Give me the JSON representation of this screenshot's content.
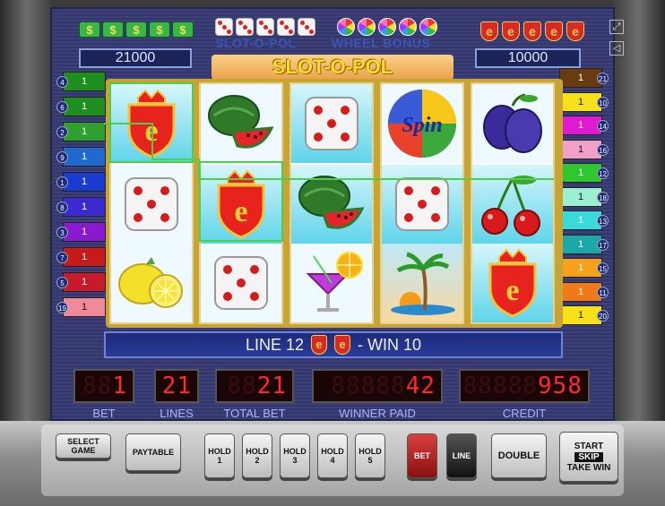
{
  "game": {
    "title": "SLOT-O-POL",
    "bonus_left": "SLOT-O-POL",
    "bonus_right": "WHEEL BONUS",
    "jackpot_left": "21000",
    "jackpot_right": "10000",
    "dollar_symbols": [
      "$",
      "$",
      "$",
      "$",
      "$"
    ],
    "shield_symbols": [
      "e",
      "e",
      "e",
      "e",
      "e"
    ]
  },
  "reels": [
    [
      "shield-e",
      "dice",
      "lemon"
    ],
    [
      "watermelon",
      "shield-e",
      "dice"
    ],
    [
      "dice",
      "watermelon",
      "cocktail"
    ],
    [
      "spin-wheel",
      "dice",
      "palm-island"
    ],
    [
      "plum",
      "cherry",
      "shield-e"
    ]
  ],
  "reel_symbol_labels": {
    "spin": "Spin",
    "shield": "e"
  },
  "line_markers_left": [
    {
      "num": "4",
      "value": "1",
      "color": "#1e8f1e"
    },
    {
      "num": "6",
      "value": "1",
      "color": "#1e8f1e"
    },
    {
      "num": "2",
      "value": "1",
      "color": "#2f9f2f"
    },
    {
      "num": "9",
      "value": "1",
      "color": "#1e6ad0"
    },
    {
      "num": "1",
      "value": "1",
      "color": "#1a3bd0"
    },
    {
      "num": "8",
      "value": "1",
      "color": "#3a2ad0"
    },
    {
      "num": "3",
      "value": "1",
      "color": "#8a1ad0"
    },
    {
      "num": "7",
      "value": "1",
      "color": "#c81a1a"
    },
    {
      "num": "5",
      "value": "1",
      "color": "#c81a2a"
    },
    {
      "num": "19",
      "value": "1",
      "color": "#f08a9a"
    }
  ],
  "line_markers_right": [
    {
      "num": "21",
      "value": "1",
      "color": "#6a3a10"
    },
    {
      "num": "10",
      "value": "1",
      "color": "#f7e21a"
    },
    {
      "num": "14",
      "value": "1",
      "color": "#e01ad0"
    },
    {
      "num": "16",
      "value": "1",
      "color": "#f3a0c8"
    },
    {
      "num": "12",
      "value": "1",
      "color": "#2ec82e"
    },
    {
      "num": "18",
      "value": "1",
      "color": "#9af0d0"
    },
    {
      "num": "13",
      "value": "1",
      "color": "#3adada"
    },
    {
      "num": "17",
      "value": "1",
      "color": "#1aa8a8"
    },
    {
      "num": "15",
      "value": "1",
      "color": "#f7a01a"
    },
    {
      "num": "11",
      "value": "1",
      "color": "#f07a1a"
    },
    {
      "num": "20",
      "value": "1",
      "color": "#f7e21a"
    }
  ],
  "win_info": {
    "line_text": "LINE 12",
    "win_text": "- WIN 10"
  },
  "displays": {
    "bet": {
      "label": "BET",
      "value": "1",
      "ghost": "88"
    },
    "lines": {
      "label": "LINES",
      "value": "21",
      "ghost": ""
    },
    "total_bet": {
      "label": "TOTAL BET",
      "value": "21",
      "ghost": "88"
    },
    "winner_paid": {
      "label": "WINNER PAID",
      "value": "42",
      "ghost": "88888"
    },
    "credit": {
      "label": "CREDIT",
      "value": "958",
      "ghost": "88888"
    }
  },
  "buttons": {
    "select_game": "SELECT GAME",
    "paytable": "PAYTABLE",
    "hold1": "HOLD 1",
    "hold2": "HOLD 2",
    "hold3": "HOLD 3",
    "hold4": "HOLD 4",
    "hold5": "HOLD 5",
    "bet": "BET",
    "line": "LINE",
    "double": "DOUBLE",
    "start": "START",
    "skip": "SKIP",
    "take_win": "TAKE WIN"
  },
  "window_icons": {
    "fullscreen": "fullscreen-icon",
    "sound": "sound-icon"
  },
  "colors": {
    "screen_bg": "#3c3f78",
    "reel_frame": "#c8a436",
    "led_red": "#ff2a2a",
    "payline_green": "#4ccf4c"
  }
}
